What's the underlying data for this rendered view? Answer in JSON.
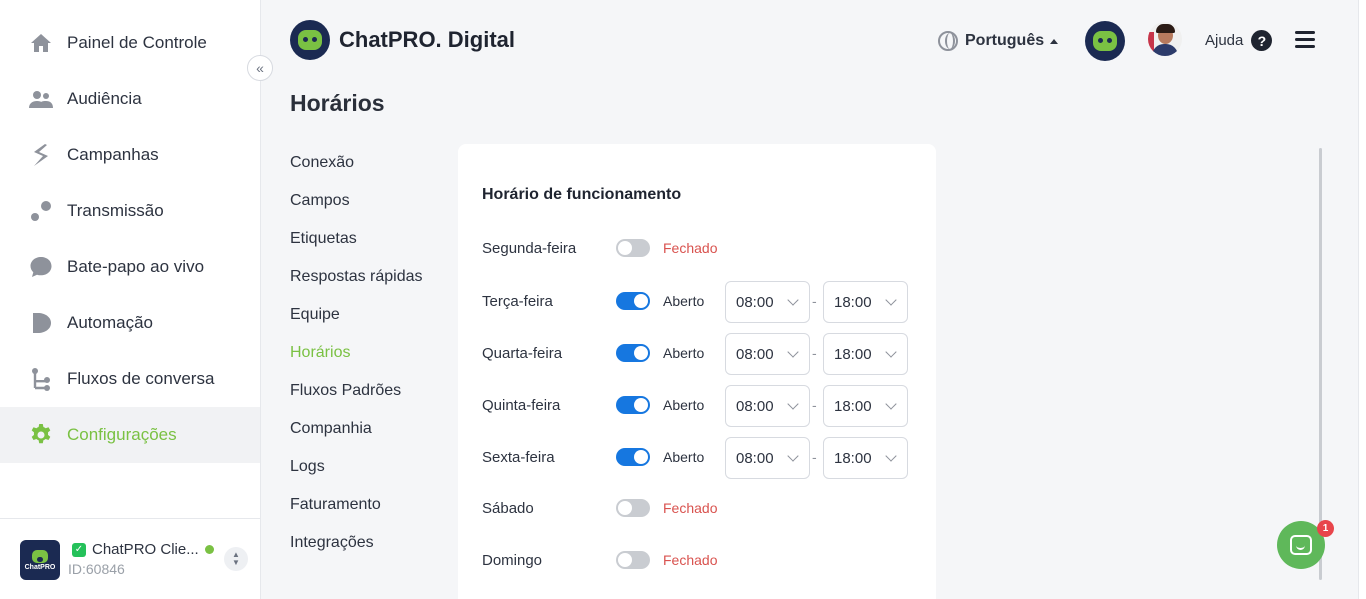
{
  "sidebar": {
    "items": [
      {
        "label": "Painel de Controle",
        "icon": "home-icon"
      },
      {
        "label": "Audiência",
        "icon": "users-icon"
      },
      {
        "label": "Campanhas",
        "icon": "campaign-icon"
      },
      {
        "label": "Transmissão",
        "icon": "broadcast-icon"
      },
      {
        "label": "Bate-papo ao vivo",
        "icon": "chat-bubble-icon"
      },
      {
        "label": "Automação",
        "icon": "automation-icon"
      },
      {
        "label": "Fluxos de conversa",
        "icon": "flow-icon"
      },
      {
        "label": "Configurações",
        "icon": "gear-icon"
      }
    ],
    "collapse_symbol": "«",
    "account": {
      "name": "ChatPRO Clie...",
      "id": "ID:60846",
      "logo_text": "ChatPRO"
    }
  },
  "header": {
    "brand": "ChatPRO. Digital",
    "language": "Português",
    "help": "Ajuda",
    "help_symbol": "?"
  },
  "page": {
    "title": "Horários"
  },
  "submenu": {
    "items": [
      "Conexão",
      "Campos",
      "Etiquetas",
      "Respostas rápidas",
      "Equipe",
      "Horários",
      "Fluxos Padrões",
      "Companhia",
      "Logs",
      "Faturamento",
      "Integrações"
    ],
    "active": "Horários"
  },
  "schedule": {
    "title": "Horário de funcionamento",
    "separator": "-",
    "days": [
      {
        "name": "Segunda-feira",
        "open": false,
        "status": "Fechado"
      },
      {
        "name": "Terça-feira",
        "open": true,
        "status": "Aberto",
        "from": "08:00",
        "to": "18:00"
      },
      {
        "name": "Quarta-feira",
        "open": true,
        "status": "Aberto",
        "from": "08:00",
        "to": "18:00"
      },
      {
        "name": "Quinta-feira",
        "open": true,
        "status": "Aberto",
        "from": "08:00",
        "to": "18:00"
      },
      {
        "name": "Sexta-feira",
        "open": true,
        "status": "Aberto",
        "from": "08:00",
        "to": "18:00"
      },
      {
        "name": "Sábado",
        "open": false,
        "status": "Fechado"
      },
      {
        "name": "Domingo",
        "open": false,
        "status": "Fechado"
      }
    ]
  },
  "chat_widget": {
    "badge": "1"
  },
  "colors": {
    "accent": "#7ac143",
    "toggle_on": "#1677e0",
    "closed": "#d9534f",
    "brand_dark": "#1b2a52"
  }
}
